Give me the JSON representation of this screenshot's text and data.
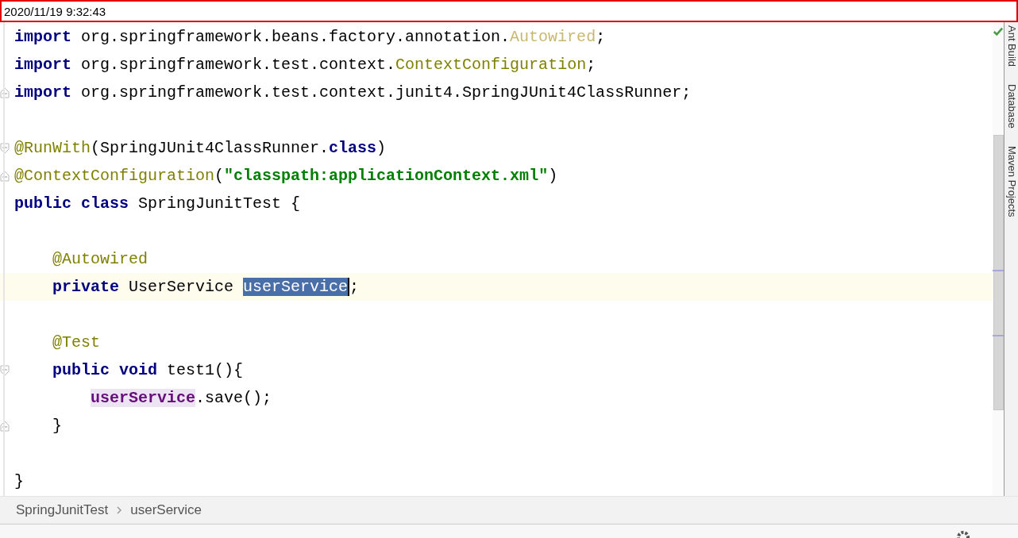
{
  "timestamp": "2020/11/19 9:32:43",
  "editor": {
    "lines": [
      {
        "kind": "code",
        "tokens": [
          {
            "kind": "keyword",
            "text": "import"
          },
          {
            "kind": "plain",
            "text": " org.springframework.beans.factory.annotation."
          },
          {
            "kind": "unused",
            "text": "Autowired"
          },
          {
            "kind": "plain",
            "text": ";"
          }
        ]
      },
      {
        "kind": "code",
        "tokens": [
          {
            "kind": "keyword",
            "text": "import"
          },
          {
            "kind": "plain",
            "text": " org.springframework.test.context."
          },
          {
            "kind": "classref",
            "text": "ContextConfiguration"
          },
          {
            "kind": "plain",
            "text": ";"
          }
        ]
      },
      {
        "kind": "code",
        "fold_end": true,
        "tokens": [
          {
            "kind": "keyword",
            "text": "import"
          },
          {
            "kind": "plain",
            "text": " org.springframework.test.context.junit4.SpringJUnit4ClassRunner;"
          }
        ]
      },
      {
        "kind": "blank"
      },
      {
        "kind": "code",
        "fold_start": true,
        "tokens": [
          {
            "kind": "annotation",
            "text": "@RunWith"
          },
          {
            "kind": "plain",
            "text": "(SpringJUnit4ClassRunner."
          },
          {
            "kind": "keyword",
            "text": "class"
          },
          {
            "kind": "plain",
            "text": ")"
          }
        ]
      },
      {
        "kind": "code",
        "fold_end": true,
        "tokens": [
          {
            "kind": "annotation",
            "text": "@ContextConfiguration"
          },
          {
            "kind": "plain",
            "text": "("
          },
          {
            "kind": "string",
            "text": "\"classpath:applicationContext.xml\""
          },
          {
            "kind": "plain",
            "text": ")"
          }
        ]
      },
      {
        "kind": "code",
        "tokens": [
          {
            "kind": "keyword",
            "text": "public class"
          },
          {
            "kind": "plain",
            "text": " SpringJunitTest {"
          }
        ],
        "children": [
          {
            "kind": "blank"
          },
          {
            "kind": "code",
            "tokens": [
              {
                "kind": "annotation",
                "text": "@Autowired"
              }
            ]
          },
          {
            "kind": "code",
            "current": true,
            "tokens": [
              {
                "kind": "keyword",
                "text": "private"
              },
              {
                "kind": "plain",
                "text": " UserService "
              },
              {
                "kind": "selection",
                "text": "userService"
              },
              {
                "kind": "plain",
                "text": ";"
              }
            ]
          },
          {
            "kind": "blank"
          },
          {
            "kind": "code",
            "tokens": [
              {
                "kind": "annotation",
                "text": "@Test"
              }
            ]
          },
          {
            "kind": "code",
            "fold_start": true,
            "tokens": [
              {
                "kind": "keyword",
                "text": "public void"
              },
              {
                "kind": "plain",
                "text": " test1(){"
              }
            ],
            "children": [
              {
                "kind": "code",
                "tokens": [
                  {
                    "kind": "usage",
                    "text": "userService"
                  },
                  {
                    "kind": "plain",
                    "text": ".save();"
                  }
                ]
              }
            ]
          },
          {
            "kind": "code",
            "fold_end": true,
            "tokens": [
              {
                "kind": "plain",
                "text": "}"
              }
            ]
          },
          {
            "kind": "blank"
          }
        ]
      },
      {
        "kind": "code",
        "tokens": [
          {
            "kind": "plain",
            "text": "}"
          }
        ]
      }
    ]
  },
  "breadcrumbs": [
    "SpringJunitTest",
    "userService"
  ],
  "tool_windows": [
    "Ant Build",
    "Database",
    "Maven Projects"
  ]
}
